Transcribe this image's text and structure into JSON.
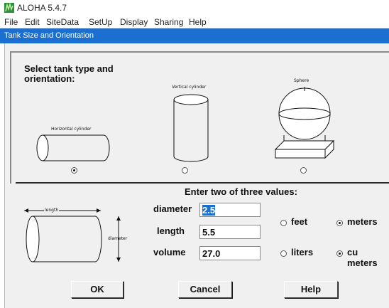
{
  "app": {
    "title": "ALOHA 5.4.7"
  },
  "menu": [
    "File",
    "Edit",
    "SiteData",
    "SetUp",
    "Display",
    "Sharing",
    "Help"
  ],
  "dialog": {
    "title": "Tank Size and Orientation",
    "type_heading_line1": "Select tank type and",
    "type_heading_line2": "orientation:",
    "tank_types": [
      {
        "label": "Horizontal cylinder",
        "selected": true
      },
      {
        "label": "Vertical cylinder",
        "selected": false
      },
      {
        "label": "Sphere",
        "selected": false
      }
    ],
    "values_heading": "Enter two of three values:",
    "diagram": {
      "length_label": "length",
      "diameter_label": "diameter"
    },
    "fields": {
      "diameter": {
        "label": "diameter",
        "value": "2.5"
      },
      "length": {
        "label": "length",
        "value": "5.5"
      },
      "volume": {
        "label": "volume",
        "value": "27.0"
      }
    },
    "length_units": [
      {
        "label": "feet",
        "selected": false
      },
      {
        "label": "meters",
        "selected": true
      }
    ],
    "volume_units": [
      {
        "label": "liters",
        "selected": false
      },
      {
        "label": "cu meters",
        "selected": true
      }
    ],
    "buttons": {
      "ok": "OK",
      "cancel": "Cancel",
      "help": "Help"
    }
  }
}
